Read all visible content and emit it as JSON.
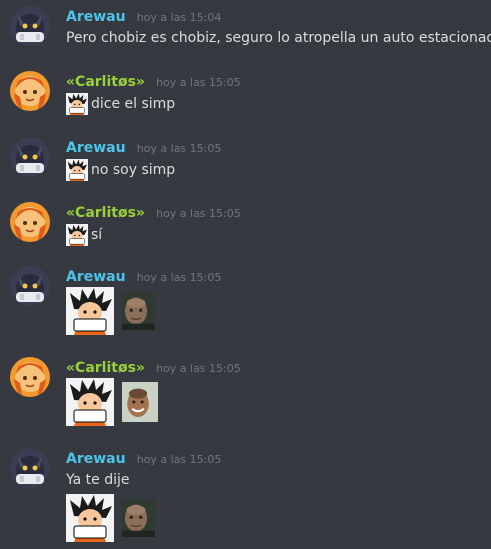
{
  "messages": [
    {
      "user": "Arewau",
      "time": "hoy a las 15:04",
      "text": "Pero chobiz es chobiz, seguro lo atropella un auto estacionado"
    },
    {
      "user": "«Carlitøs»",
      "time": "hoy a las 15:05",
      "text": "dice el simp"
    },
    {
      "user": "Arewau",
      "time": "hoy a las 15:05",
      "text": "no soy simp"
    },
    {
      "user": "«Carlitøs»",
      "time": "hoy a las 15:05",
      "text": "sí"
    },
    {
      "user": "Arewau",
      "time": "hoy a las 15:05"
    },
    {
      "user": "«Carlitøs»",
      "time": "hoy a las 15:05"
    },
    {
      "user": "Arewau",
      "time": "hoy a las 15:05",
      "text": "Ya te dije"
    }
  ],
  "emoji": {
    "goku_label": "que"
  },
  "colors": {
    "background": "#36393f",
    "arewau": "#4fc4e8",
    "carlitos": "#9ad03a",
    "text": "#dcddde",
    "timestamp": "#72767d"
  }
}
